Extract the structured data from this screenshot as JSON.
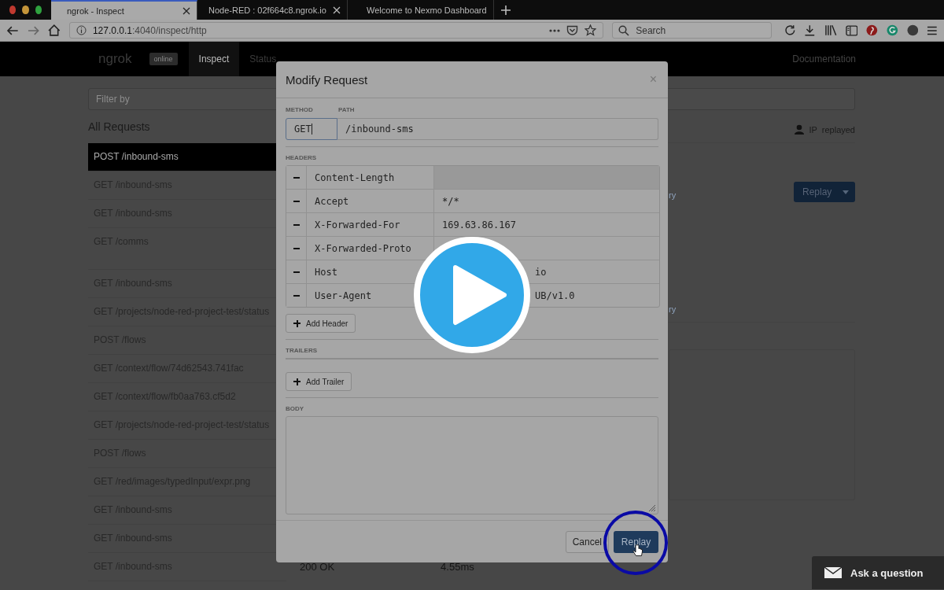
{
  "browser": {
    "tabs": [
      {
        "title": "ngrok - Inspect",
        "selected": true
      },
      {
        "title": "Node-RED : 02f664c8.ngrok.io",
        "selected": false
      },
      {
        "title": "Welcome to Nexmo Dashboard",
        "selected": false
      }
    ],
    "url_host": "127.0.0.1",
    "url_path": ":4040/inspect/http",
    "search_placeholder": "Search"
  },
  "ngrok": {
    "brand": "ngrok",
    "status": "online",
    "nav": [
      {
        "label": "Inspect",
        "selected": true
      },
      {
        "label": "Status",
        "selected": false
      }
    ],
    "docs": "Documentation"
  },
  "filter": {
    "placeholder": "Filter by"
  },
  "requests": {
    "title": "All Requests",
    "items": [
      {
        "label": "POST /inbound-sms",
        "selected": true
      },
      {
        "label": "GET /inbound-sms",
        "selected": false
      },
      {
        "label": "GET /inbound-sms",
        "selected": false
      },
      {
        "label": "GET /comms",
        "selected": false
      },
      {
        "label": "GET /inbound-sms",
        "selected": false
      },
      {
        "label": "GET /projects/node-red-project-test/status",
        "selected": false
      },
      {
        "label": "POST /flows",
        "selected": false
      },
      {
        "label": "GET /context/flow/74d62543.741fac",
        "selected": false
      },
      {
        "label": "GET /context/flow/fb0aa763.cf5d2",
        "selected": false
      },
      {
        "label": "GET /projects/node-red-project-test/status",
        "selected": false
      },
      {
        "label": "POST /flows",
        "selected": false
      },
      {
        "label": "GET /red/images/typedInput/expr.png",
        "selected": false
      },
      {
        "label": "GET /inbound-sms",
        "selected": false
      },
      {
        "label": "GET /inbound-sms",
        "selected": false
      },
      {
        "label": "GET /inbound-sms",
        "selected": false
      }
    ]
  },
  "detail": {
    "ip": "IP",
    "replayed": "replayed",
    "replay": "Replay",
    "fragments": [
      "ry",
      "ry"
    ],
    "status": "200 OK",
    "duration": "4.55ms"
  },
  "modal": {
    "title": "Modify Request",
    "close": "×",
    "method_label": "METHOD",
    "path_label": "PATH",
    "method": "GET",
    "path": "/inbound-sms",
    "headers_label": "HEADERS",
    "headers": [
      {
        "name": "Content-Length",
        "disabled": true
      },
      {
        "name": "Accept",
        "value": "*/*",
        "disabled": false
      },
      {
        "name": "X-Forwarded-For",
        "value": "169.63.86.167",
        "disabled": false
      },
      {
        "name": "X-Forwarded-Proto",
        "disabled": false
      },
      {
        "name": "Host",
        "value": "io",
        "disabled": false,
        "partially_hidden": true
      },
      {
        "name": "User-Agent",
        "value": "UB/v1.0",
        "disabled": false,
        "partially_hidden": true
      }
    ],
    "add_header": "Add Header",
    "trailers_label": "TRAILERS",
    "add_trailer": "Add Trailer",
    "body_label": "BODY",
    "cancel": "Cancel",
    "replay": "Replay"
  },
  "chat": {
    "label": "Ask a question"
  }
}
